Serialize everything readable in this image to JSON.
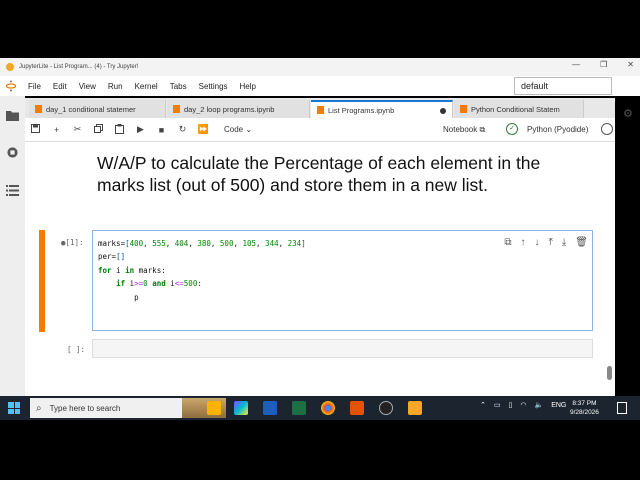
{
  "window": {
    "title": "JupyterLite - List Program... (4) - Try Jupyter!",
    "controls": [
      "—",
      "❐",
      "✕"
    ]
  },
  "menu": {
    "items": [
      "File",
      "Edit",
      "View",
      "Run",
      "Kernel",
      "Tabs",
      "Settings",
      "Help"
    ],
    "kernel_select": "default"
  },
  "tabs": [
    {
      "label": "day_1 conditional statemer",
      "active": false
    },
    {
      "label": "day_2 loop programs.ipynb",
      "active": false
    },
    {
      "label": "List Programs.ipynb",
      "active": true
    },
    {
      "label": "Python Conditional Statem",
      "active": false
    }
  ],
  "toolbar": {
    "cell_type": "Code",
    "notebook_label": "Notebook",
    "kernel_label": "Python (Pyodide)"
  },
  "notebook": {
    "heading": "W/A/P to calculate the Percentage of each element in the marks list (out of 500) and store them in a new list.",
    "code_prompt": "●[1]:",
    "empty_prompt": "[ ]:",
    "code_lines": [
      "marks=[400, 555, 404, 380, 500, 105, 344, 234]",
      "per=[]",
      "for i in marks:",
      "    if i>=0 and i<=500:",
      "        p"
    ]
  },
  "taskbar": {
    "search_placeholder": "Type here to search",
    "language": "ENG",
    "time": "8:37 PM",
    "date": "9/28/2026"
  },
  "colors": {
    "accent": "#1976d2",
    "active_cell": "#f57c00",
    "taskbar": "#1c2430"
  }
}
